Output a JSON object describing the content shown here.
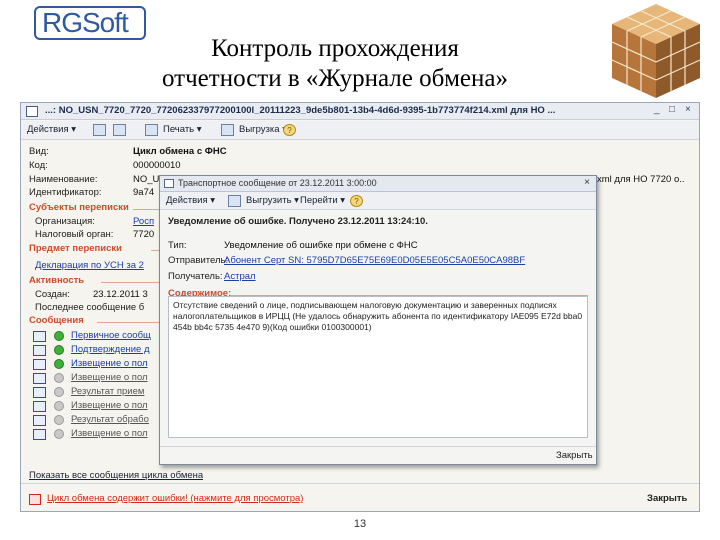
{
  "slide": {
    "logo_text": "RGSoft",
    "title_line1": "Контроль прохождения",
    "title_line2": "отчетности в «Журнале обмена»",
    "page_number": "13"
  },
  "window": {
    "title": "...: NO_USN_7720_7720_772062337977200100l_20111223_9de5b801-13b4-4d6d-9395-1b773774f214.xml для НО ...",
    "controls": [
      "_",
      "□",
      "×"
    ],
    "toolbar": {
      "actions": "Действия ▾",
      "print": "Печать ▾",
      "upload": "Выгрузка ▾"
    },
    "fields": {
      "vid_label": "Вид:",
      "vid_value": "Цикл обмена с ФНС",
      "kod_label": "Код:",
      "kod_value": "000000010",
      "name_label": "Наименование:",
      "name_value": "NO_U",
      "name_value_tail": "xml для НО 7720 о..",
      "id_label": "Идентификатор:",
      "id_value": "9a74"
    },
    "sections": {
      "subjects": "Субъекты переписки",
      "subject": "Предмет переписки",
      "activity": "Активность",
      "messages": "Сообщения"
    },
    "subjects": {
      "org_label": "Организация:",
      "org_value": "Росп",
      "tax_label": "Налоговый орган:",
      "tax_value": "7720"
    },
    "subject_link": "Декларация по УСН за 2",
    "activity": {
      "created_label": "Создан:",
      "created_value": "23.12.2011 3",
      "last_label": "Последнее сообщение б"
    },
    "messages": [
      {
        "label": "Первичное сообщ",
        "color": "#3fb03a",
        "link_color": "#1a3fa8",
        "icon": "envelope-icon"
      },
      {
        "label": "Подтверждение д",
        "color": "#3fb03a",
        "link_color": "#1a3fa8",
        "icon": "envelope-icon"
      },
      {
        "label": "Извещение о пол",
        "color": "#3fb03a",
        "link_color": "#1a3fa8",
        "icon": "envelope-icon"
      },
      {
        "label": "Извещение о пол",
        "color": "#c8c8c8",
        "link_color": "#555555",
        "icon": "envelope-icon"
      },
      {
        "label": "Результат прием",
        "color": "#c8c8c8",
        "link_color": "#555555",
        "icon": "envelope-icon"
      },
      {
        "label": "Извещение о пол",
        "color": "#c8c8c8",
        "link_color": "#555555",
        "icon": "envelope-icon"
      },
      {
        "label": "Результат обрабо",
        "color": "#c8c8c8",
        "link_color": "#555555",
        "icon": "envelope-icon"
      },
      {
        "label": "Извещение о пол",
        "color": "#c8c8c8",
        "link_color": "#555555",
        "icon": "envelope-icon"
      }
    ],
    "show_all_link": "Показать все сообщения цикла обмена",
    "error_link": "Цикл обмена содержит ошибки! (нажмите для просмотра)",
    "close_label": "Закрыть",
    "accent_color": "#c94d2a",
    "error_color": "#d8261b"
  },
  "dialog": {
    "title": "Транспортное сообщение от 23.12.2011 3:00:00",
    "close_glyph": "×",
    "toolbar": {
      "actions": "Действия ▾",
      "upload": "Выгрузить ▾",
      "goto": "Перейти ▾"
    },
    "header": "Уведомление об ошибке. Получено 23.12.2011 13:24:10.",
    "type_label": "Тип:",
    "type_value": "Уведомление об ошибке при обмене с ФНС",
    "sender_label": "Отправитель:",
    "sender_value": "Абонент Серт SN: 5795D7D65E75E69E0D05E5E05C5A0E50CA98BF",
    "recipient_label": "Получатель:",
    "recipient_value": "Астрал",
    "content_label": "Содержимое:",
    "content_text": "Отсутствие сведений о лице, подписывающем налоговую документацию и заверенных подписях налогоплательщиков в ИРЦЦ (Не удалось обнаружить абонента по идентификатору IAE095 E72d bba0 454b bb4c 5735 4e470 9)(Код ошибки 0100300001)",
    "close_label": "Закрыть"
  }
}
